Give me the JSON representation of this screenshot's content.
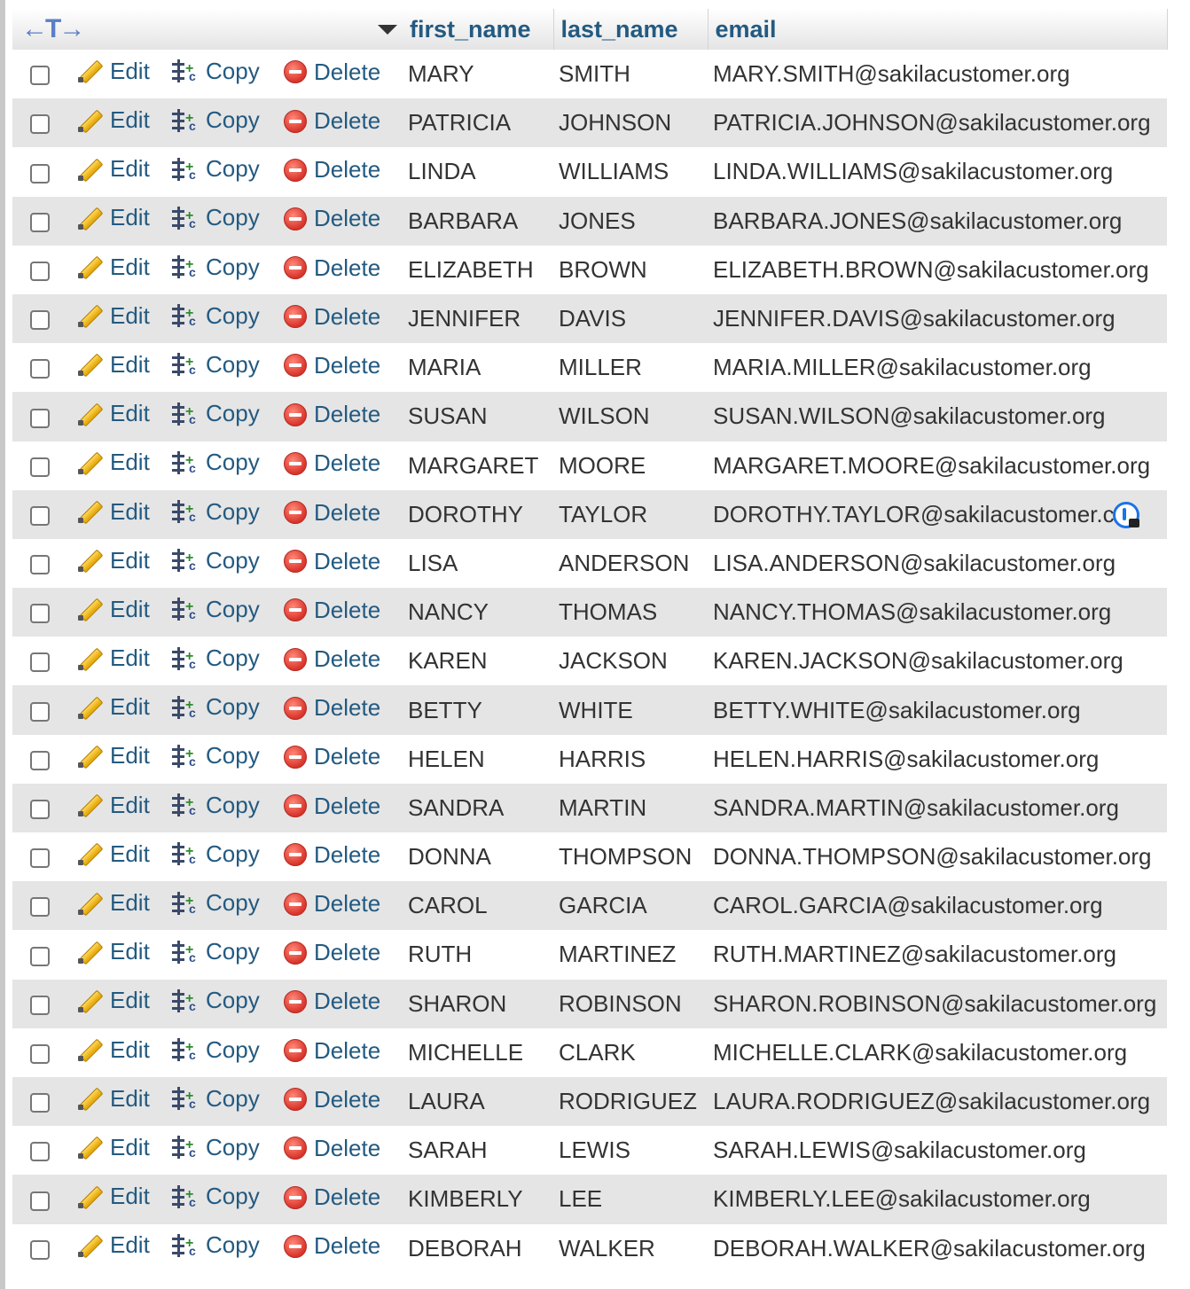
{
  "header": {
    "arrows": "←T→",
    "columns": [
      "first_name",
      "last_name",
      "email"
    ]
  },
  "actions": {
    "edit": "Edit",
    "copy": "Copy",
    "delete": "Delete"
  },
  "rows": [
    {
      "first_name": "MARY",
      "last_name": "SMITH",
      "email": "MARY.SMITH@sakilacustomer.org"
    },
    {
      "first_name": "PATRICIA",
      "last_name": "JOHNSON",
      "email": "PATRICIA.JOHNSON@sakilacustomer.org"
    },
    {
      "first_name": "LINDA",
      "last_name": "WILLIAMS",
      "email": "LINDA.WILLIAMS@sakilacustomer.org"
    },
    {
      "first_name": "BARBARA",
      "last_name": "JONES",
      "email": "BARBARA.JONES@sakilacustomer.org"
    },
    {
      "first_name": "ELIZABETH",
      "last_name": "BROWN",
      "email": "ELIZABETH.BROWN@sakilacustomer.org"
    },
    {
      "first_name": "JENNIFER",
      "last_name": "DAVIS",
      "email": "JENNIFER.DAVIS@sakilacustomer.org"
    },
    {
      "first_name": "MARIA",
      "last_name": "MILLER",
      "email": "MARIA.MILLER@sakilacustomer.org"
    },
    {
      "first_name": "SUSAN",
      "last_name": "WILSON",
      "email": "SUSAN.WILSON@sakilacustomer.org"
    },
    {
      "first_name": "MARGARET",
      "last_name": "MOORE",
      "email": "MARGARET.MOORE@sakilacustomer.org"
    },
    {
      "first_name": "DOROTHY",
      "last_name": "TAYLOR",
      "email": "DOROTHY.TAYLOR@sakilacustomer.c"
    },
    {
      "first_name": "LISA",
      "last_name": "ANDERSON",
      "email": "LISA.ANDERSON@sakilacustomer.org"
    },
    {
      "first_name": "NANCY",
      "last_name": "THOMAS",
      "email": "NANCY.THOMAS@sakilacustomer.org"
    },
    {
      "first_name": "KAREN",
      "last_name": "JACKSON",
      "email": "KAREN.JACKSON@sakilacustomer.org"
    },
    {
      "first_name": "BETTY",
      "last_name": "WHITE",
      "email": "BETTY.WHITE@sakilacustomer.org"
    },
    {
      "first_name": "HELEN",
      "last_name": "HARRIS",
      "email": "HELEN.HARRIS@sakilacustomer.org"
    },
    {
      "first_name": "SANDRA",
      "last_name": "MARTIN",
      "email": "SANDRA.MARTIN@sakilacustomer.org"
    },
    {
      "first_name": "DONNA",
      "last_name": "THOMPSON",
      "email": "DONNA.THOMPSON@sakilacustomer.org"
    },
    {
      "first_name": "CAROL",
      "last_name": "GARCIA",
      "email": "CAROL.GARCIA@sakilacustomer.org"
    },
    {
      "first_name": "RUTH",
      "last_name": "MARTINEZ",
      "email": "RUTH.MARTINEZ@sakilacustomer.org"
    },
    {
      "first_name": "SHARON",
      "last_name": "ROBINSON",
      "email": "SHARON.ROBINSON@sakilacustomer.org"
    },
    {
      "first_name": "MICHELLE",
      "last_name": "CLARK",
      "email": "MICHELLE.CLARK@sakilacustomer.org"
    },
    {
      "first_name": "LAURA",
      "last_name": "RODRIGUEZ",
      "email": "LAURA.RODRIGUEZ@sakilacustomer.org"
    },
    {
      "first_name": "SARAH",
      "last_name": "LEWIS",
      "email": "SARAH.LEWIS@sakilacustomer.org"
    },
    {
      "first_name": "KIMBERLY",
      "last_name": "LEE",
      "email": "KIMBERLY.LEE@sakilacustomer.org"
    },
    {
      "first_name": "DEBORAH",
      "last_name": "WALKER",
      "email": "DEBORAH.WALKER@sakilacustomer.org"
    }
  ],
  "colors": {
    "link": "#235a81",
    "row_alt": "#e5e5e5",
    "text": "#333333"
  }
}
